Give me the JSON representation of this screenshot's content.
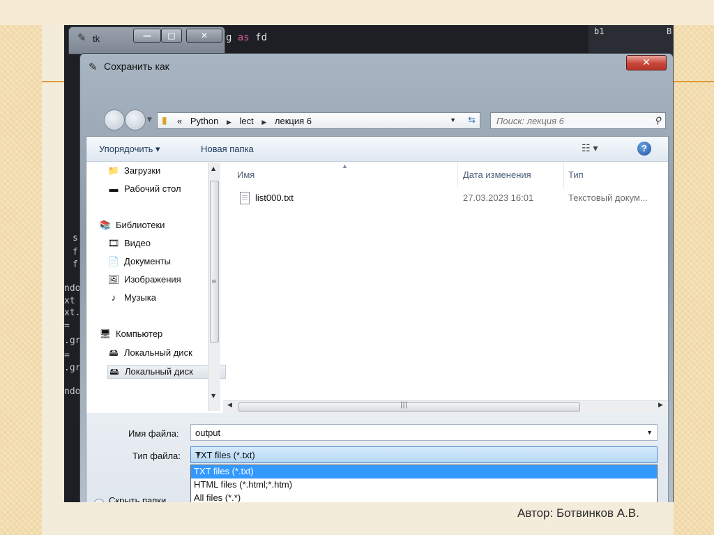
{
  "slide": {
    "author": "Автор: Ботвинков А.В."
  },
  "editor": {
    "code_fragment_kw": "as",
    "code_fragment_name": "fd",
    "gutter": [
      "s",
      "f",
      "f",
      "ndo",
      "xt",
      "xt.",
      "=",
      ".gr",
      "=",
      ".gr",
      "ndo"
    ],
    "right_panel_b1": "b1",
    "right_panel_b": "B"
  },
  "tk_window": {
    "title": "tk",
    "min": "—",
    "max": "□",
    "close": "✕"
  },
  "dialog": {
    "title": "Сохранить как",
    "close": "✕",
    "address": {
      "prefix": "«",
      "crumbs": [
        "Python",
        "lect",
        "лекция 6"
      ]
    },
    "search_placeholder": "Поиск: лекция 6",
    "toolbar": {
      "organize": "Упорядочить ▾",
      "new_folder": "Новая папка",
      "views": "☷ ▾",
      "help": "?"
    },
    "nav_items": [
      {
        "icon": "downloads-folder-icon",
        "glyph": "📁",
        "label": "Загрузки",
        "indent": 1
      },
      {
        "icon": "desktop-icon",
        "glyph": "▬",
        "label": "Рабочий стол",
        "indent": 1
      },
      {
        "icon": "libraries-icon",
        "glyph": "📚",
        "label": "Библиотеки",
        "indent": 0
      },
      {
        "icon": "video-icon",
        "glyph": "🎞",
        "label": "Видео",
        "indent": 1
      },
      {
        "icon": "documents-icon",
        "glyph": "📄",
        "label": "Документы",
        "indent": 1
      },
      {
        "icon": "pictures-icon",
        "glyph": "🖼",
        "label": "Изображения",
        "indent": 1
      },
      {
        "icon": "music-icon",
        "glyph": "♪",
        "label": "Музыка",
        "indent": 1
      },
      {
        "icon": "computer-icon",
        "glyph": "🖥",
        "label": "Компьютер",
        "indent": 0
      },
      {
        "icon": "local-disk-icon",
        "glyph": "🖴",
        "label": "Локальный диск",
        "indent": 1
      },
      {
        "icon": "local-disk-icon",
        "glyph": "🖴",
        "label": "Локальный диск",
        "indent": 1
      }
    ],
    "columns": {
      "name": "Имя",
      "date": "Дата изменения",
      "type": "Тип"
    },
    "files": [
      {
        "name": "list000.txt",
        "date": "27.03.2023 16:01",
        "type": "Текстовый докум..."
      }
    ],
    "form": {
      "filename_label": "Имя файла:",
      "filename_value": "output",
      "filetype_label": "Тип файла:",
      "filetype_value": "TXT files (*.txt)",
      "filetype_options": [
        "TXT files (*.txt)",
        "HTML files (*.html;*.htm)",
        "All files (*.*)"
      ],
      "hide_folders": "Скрыть папки"
    }
  },
  "colors": {
    "selection": "#3399ff",
    "accent_line": "#e09a3a",
    "close_red": "#c7463a"
  }
}
